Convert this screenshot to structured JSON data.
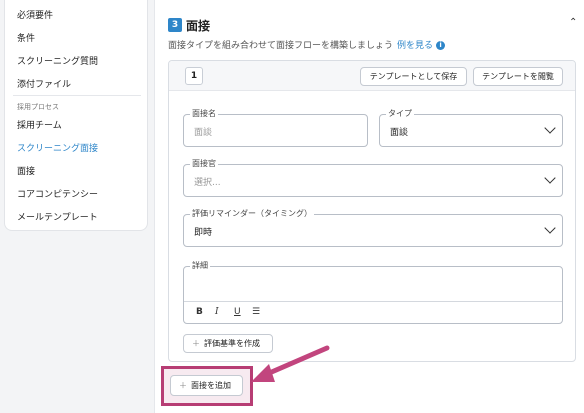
{
  "sidebar": {
    "items": [
      {
        "label": "必須要件"
      },
      {
        "label": "条件"
      },
      {
        "label": "スクリーニング質問"
      },
      {
        "label": "添付ファイル"
      }
    ],
    "section_label": "採用プロセス",
    "process_items": [
      {
        "label": "採用チーム"
      },
      {
        "label": "スクリーニング面接",
        "active": true
      },
      {
        "label": "面接"
      },
      {
        "label": "コアコンピテンシー"
      },
      {
        "label": "メールテンプレート"
      }
    ]
  },
  "section": {
    "step_number": "3",
    "title": "面接",
    "subtitle": "面接タイプを組み合わせて面接フローを構築しましょう",
    "example_link": "例を見る",
    "info_icon": "i"
  },
  "interview": {
    "number": "1",
    "save_template": "テンプレートとして保存",
    "browse_template": "テンプレートを閲覧",
    "name_label": "面接名",
    "name_placeholder": "面談",
    "type_label": "タイプ",
    "type_value": "面談",
    "interviewer_label": "面接官",
    "interviewer_placeholder": "選択...",
    "reminder_label": "評価リマインダー（タイミング）",
    "reminder_value": "即時",
    "details_label": "詳細",
    "toolbar": {
      "bold": "B",
      "italic": "I",
      "underline": "U",
      "list": "☰"
    },
    "create_criteria": "評価基準を作成"
  },
  "add_interview": "面接を追加",
  "highlight_color": "#b73d74"
}
